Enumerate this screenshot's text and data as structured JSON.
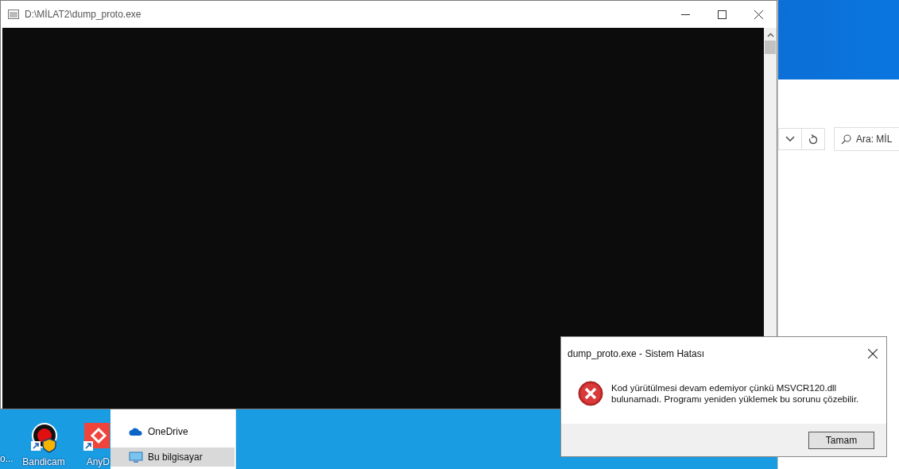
{
  "console_window": {
    "title": "D:\\MİLAT2\\dump_proto.exe"
  },
  "explorer": {
    "search": {
      "placeholder": "Ara: MİL"
    },
    "nav_items": [
      {
        "label": "OneDrive",
        "kind": "cloud",
        "selected": false
      },
      {
        "label": "Bu bilgisayar",
        "kind": "computer",
        "selected": true
      }
    ]
  },
  "desktop_icons": [
    {
      "label": "o...",
      "kind": "none"
    },
    {
      "label": "Bandicam",
      "kind": "record"
    },
    {
      "label": "AnyD",
      "kind": "remote"
    }
  ],
  "dialog": {
    "title": "dump_proto.exe - Sistem Hatası",
    "message": "Kod yürütülmesi devam edemiyor çünkü MSVCR120.dll bulunamadı. Programı yeniden yüklemek bu sorunu çözebilir.",
    "buttons": [
      "Tamam"
    ]
  }
}
